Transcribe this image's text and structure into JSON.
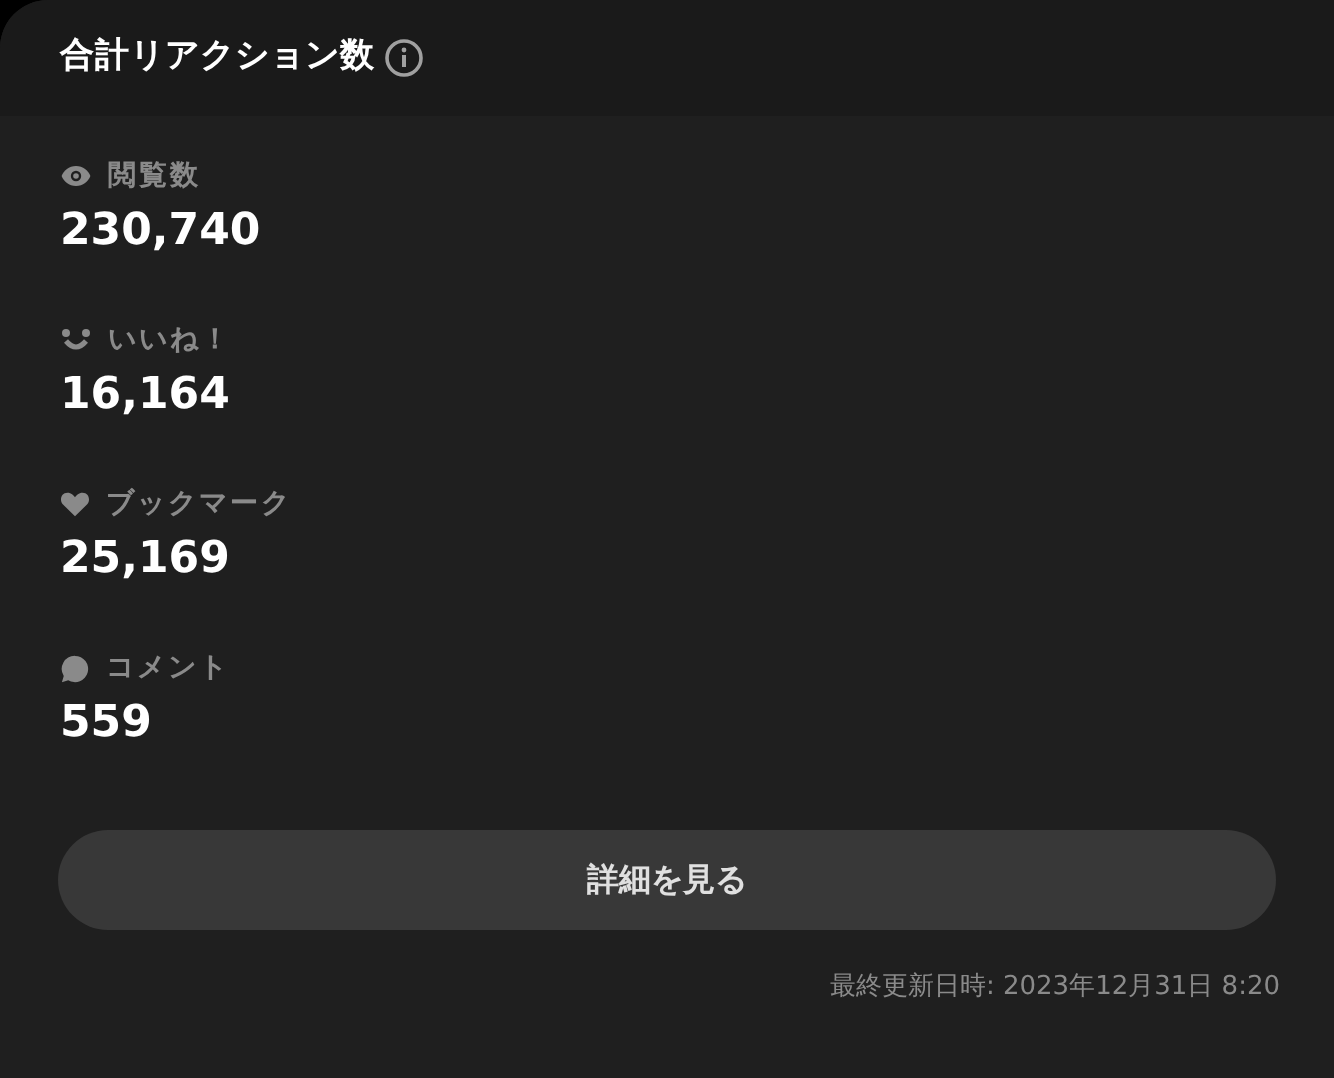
{
  "title": "合計リアクション数",
  "stats": [
    {
      "kind": "views",
      "label": "閲覧数",
      "value": "230,740"
    },
    {
      "kind": "likes",
      "label": "いいね！",
      "value": "16,164"
    },
    {
      "kind": "bookmarks",
      "label": "ブックマーク",
      "value": "25,169"
    },
    {
      "kind": "comments",
      "label": "コメント",
      "value": "559"
    }
  ],
  "button": "詳細を見る",
  "updated": "最終更新日時: 2023年12月31日 8:20"
}
